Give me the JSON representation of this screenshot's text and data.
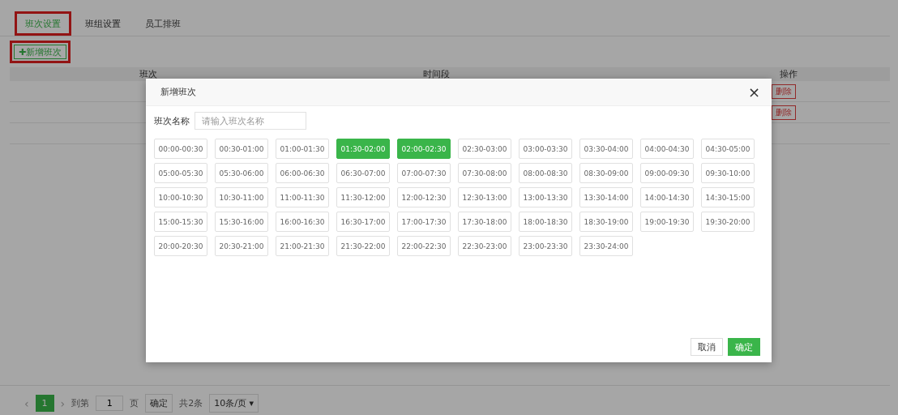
{
  "tabs": [
    {
      "label": "班次设置",
      "selected": true,
      "highlighted": true
    },
    {
      "label": "班组设置",
      "selected": false,
      "highlighted": false
    },
    {
      "label": "员工排班",
      "selected": false,
      "highlighted": false
    }
  ],
  "add_button": {
    "label": "✚新增班次",
    "highlighted": true
  },
  "table": {
    "columns": [
      "班次",
      "时间段",
      "操作"
    ],
    "rows": [
      {
        "action": "删除"
      },
      {
        "action": "删除"
      },
      {
        "action": null
      }
    ]
  },
  "pagination": {
    "prev": "‹",
    "pages": [
      {
        "label": "1",
        "selected": true
      }
    ],
    "next": "›",
    "goto_label": "到第",
    "page_value": "1",
    "page_unit": "页",
    "confirm": "确定",
    "total": "共2条",
    "page_size": "10条/页 ▾"
  },
  "dialog": {
    "title": "新增班次",
    "close": "×",
    "name_label": "班次名称",
    "name_placeholder": "请输入班次名称",
    "slots": [
      {
        "label": "00:00-00:30",
        "selected": false
      },
      {
        "label": "00:30-01:00",
        "selected": false
      },
      {
        "label": "01:00-01:30",
        "selected": false
      },
      {
        "label": "01:30-02:00",
        "selected": true
      },
      {
        "label": "02:00-02:30",
        "selected": true
      },
      {
        "label": "02:30-03:00",
        "selected": false
      },
      {
        "label": "03:00-03:30",
        "selected": false
      },
      {
        "label": "03:30-04:00",
        "selected": false
      },
      {
        "label": "04:00-04:30",
        "selected": false
      },
      {
        "label": "04:30-05:00",
        "selected": false
      },
      {
        "label": "05:00-05:30",
        "selected": false
      },
      {
        "label": "05:30-06:00",
        "selected": false
      },
      {
        "label": "06:00-06:30",
        "selected": false
      },
      {
        "label": "06:30-07:00",
        "selected": false
      },
      {
        "label": "07:00-07:30",
        "selected": false
      },
      {
        "label": "07:30-08:00",
        "selected": false
      },
      {
        "label": "08:00-08:30",
        "selected": false
      },
      {
        "label": "08:30-09:00",
        "selected": false
      },
      {
        "label": "09:00-09:30",
        "selected": false
      },
      {
        "label": "09:30-10:00",
        "selected": false
      },
      {
        "label": "10:00-10:30",
        "selected": false
      },
      {
        "label": "10:30-11:00",
        "selected": false
      },
      {
        "label": "11:00-11:30",
        "selected": false
      },
      {
        "label": "11:30-12:00",
        "selected": false
      },
      {
        "label": "12:00-12:30",
        "selected": false
      },
      {
        "label": "12:30-13:00",
        "selected": false
      },
      {
        "label": "13:00-13:30",
        "selected": false
      },
      {
        "label": "13:30-14:00",
        "selected": false
      },
      {
        "label": "14:00-14:30",
        "selected": false
      },
      {
        "label": "14:30-15:00",
        "selected": false
      },
      {
        "label": "15:00-15:30",
        "selected": false
      },
      {
        "label": "15:30-16:00",
        "selected": false
      },
      {
        "label": "16:00-16:30",
        "selected": false
      },
      {
        "label": "16:30-17:00",
        "selected": false
      },
      {
        "label": "17:00-17:30",
        "selected": false
      },
      {
        "label": "17:30-18:00",
        "selected": false
      },
      {
        "label": "18:00-18:30",
        "selected": false
      },
      {
        "label": "18:30-19:00",
        "selected": false
      },
      {
        "label": "19:00-19:30",
        "selected": false
      },
      {
        "label": "19:30-20:00",
        "selected": false
      },
      {
        "label": "20:00-20:30",
        "selected": false
      },
      {
        "label": "20:30-21:00",
        "selected": false
      },
      {
        "label": "21:00-21:30",
        "selected": false
      },
      {
        "label": "21:30-22:00",
        "selected": false
      },
      {
        "label": "22:00-22:30",
        "selected": false
      },
      {
        "label": "22:30-23:00",
        "selected": false
      },
      {
        "label": "23:00-23:30",
        "selected": false
      },
      {
        "label": "23:30-24:00",
        "selected": false
      }
    ],
    "cancel": "取消",
    "ok": "确定"
  }
}
